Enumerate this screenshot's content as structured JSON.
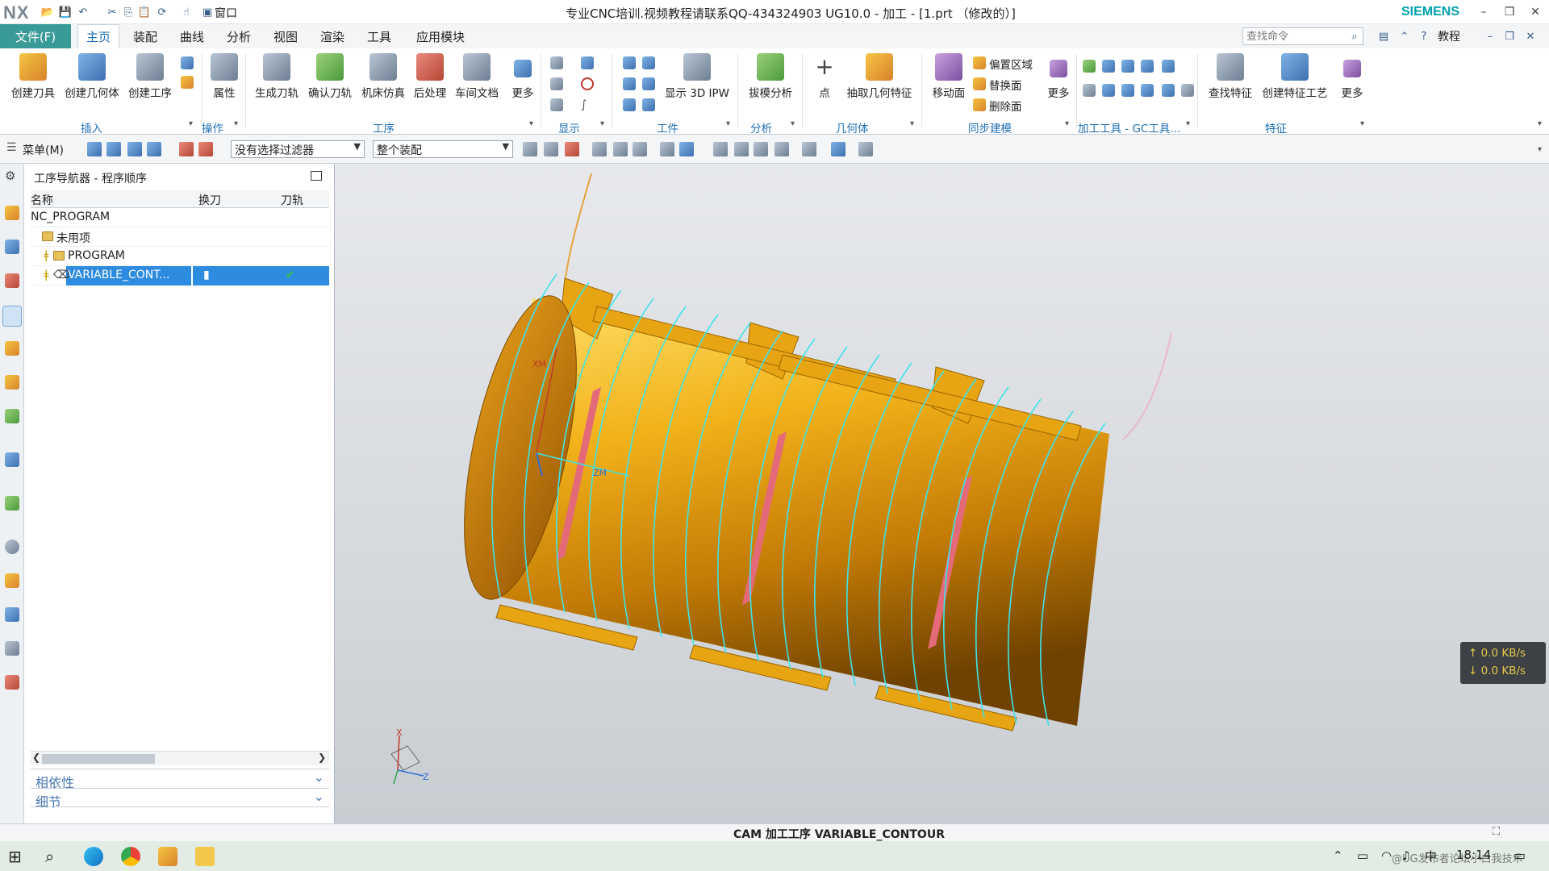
{
  "titlebar": {
    "logo": "NX",
    "window_title": "专业CNC培训.视频教程请联系QQ-434324903 UG10.0 - 加工 - [1.prt （修改的）]",
    "brand": "SIEMENS",
    "quick_access": {
      "window_label": "窗口"
    }
  },
  "tabs": {
    "file": "文件(F)",
    "items": [
      "主页",
      "装配",
      "曲线",
      "分析",
      "视图",
      "渲染",
      "工具",
      "应用模块"
    ],
    "active": "主页",
    "search_placeholder": "查找命令",
    "tutorial": "教程"
  },
  "ribbon": {
    "insert": {
      "label": "插入",
      "buttons": [
        "创建刀具",
        "创建几何体",
        "创建工序"
      ]
    },
    "operation": {
      "label": "操作",
      "buttons": [
        "属性"
      ]
    },
    "process": {
      "label": "工序",
      "buttons": [
        "生成刀轨",
        "确认刀轨",
        "机床仿真",
        "后处理",
        "车间文档",
        "更多"
      ]
    },
    "display": {
      "label": "显示"
    },
    "workpiece": {
      "label": "工件",
      "buttons": [
        "显示 3D IPW"
      ]
    },
    "analysis": {
      "label": "分析",
      "buttons": [
        "拔模分析"
      ]
    },
    "geometry": {
      "label": "几何体",
      "buttons": [
        "点",
        "抽取几何特征"
      ]
    },
    "sync": {
      "label": "同步建模",
      "buttons": [
        "移动面",
        "偏置区域",
        "替换面",
        "删除面",
        "更多"
      ]
    },
    "machining_tools": {
      "label": "加工工具 - GC工具..."
    },
    "feature": {
      "label": "特征",
      "buttons": [
        "查找特征",
        "创建特征工艺",
        "更多"
      ]
    }
  },
  "selection_bar": {
    "menu": "菜单(M)",
    "filter": "没有选择过滤器",
    "scope": "整个装配"
  },
  "navigator": {
    "title": "工序导航器 - 程序顺序",
    "columns": [
      "名称",
      "换刀",
      "刀轨"
    ],
    "rows": [
      {
        "name": "NC_PROGRAM"
      },
      {
        "name": "未用项"
      },
      {
        "name": "PROGRAM"
      },
      {
        "name": "VARIABLE_CONT...",
        "selected": true,
        "toolpath_status": "✔"
      }
    ],
    "sections": [
      "相依性",
      "细节"
    ]
  },
  "viewport": {
    "triad_labels": {
      "x": "X",
      "z": "Z",
      "xm": "XM",
      "zm": "ZM"
    },
    "net_speed": {
      "up": "↑ 0.0 KB/s",
      "down": "↓ 0.0 KB/s"
    }
  },
  "status": {
    "text": "CAM 加工工序 VARIABLE_CONTOUR"
  },
  "taskbar": {
    "time": "18:14",
    "ime": "中",
    "watermark": "@UG发布者论坛小白我技术"
  },
  "colors": {
    "part": "#f2b21a",
    "toolpath": "#3fe3e8",
    "accent": "#1f6fb5",
    "file_tab": "#3a9a97",
    "brand": "#00a0b0"
  }
}
